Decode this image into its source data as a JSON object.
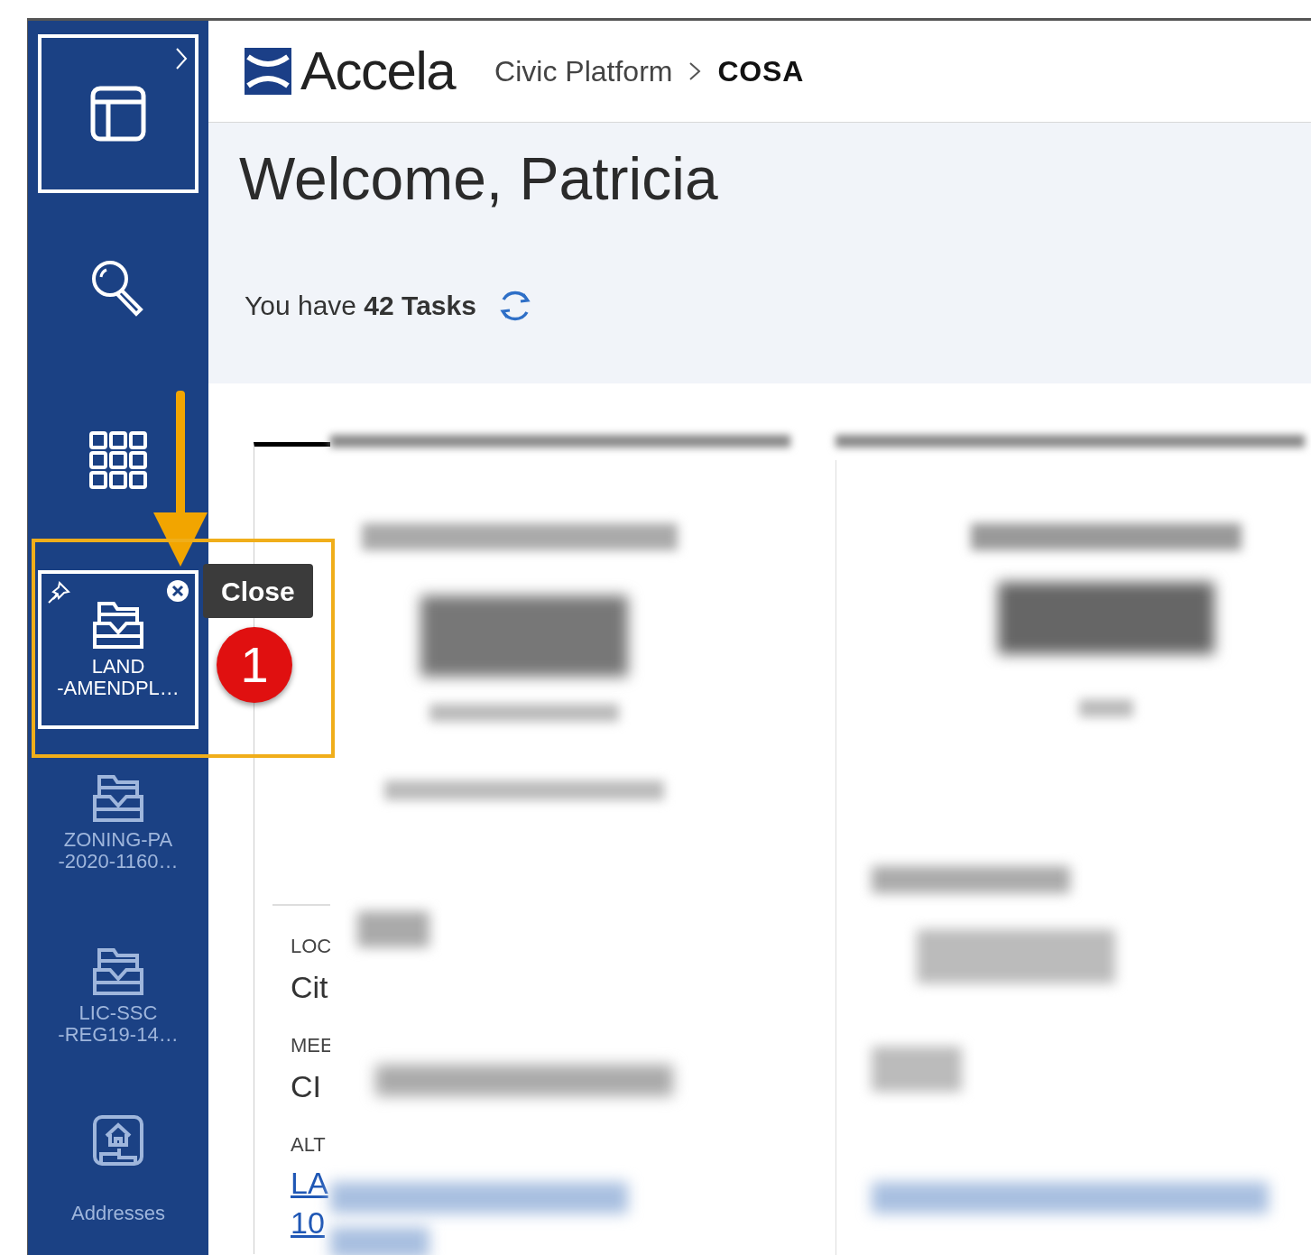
{
  "header": {
    "logo_text": "Accela",
    "breadcrumb": [
      {
        "label": "Civic Platform",
        "current": false
      },
      {
        "label": "COSA",
        "current": true
      }
    ]
  },
  "sidebar": {
    "items": [
      {
        "kind": "dashboard",
        "selected": true,
        "expand": true
      },
      {
        "kind": "search",
        "selected": false
      },
      {
        "kind": "apps",
        "selected": false
      },
      {
        "kind": "record",
        "selected": true,
        "label_lines": [
          "LAND",
          "-AMENDPL…"
        ]
      },
      {
        "kind": "record",
        "selected": false,
        "label_lines": [
          "ZONING-PA",
          "-2020-1160…"
        ]
      },
      {
        "kind": "record",
        "selected": false,
        "label_lines": [
          "LIC-SSC",
          "-REG19-14…"
        ]
      },
      {
        "kind": "addresses",
        "selected": false,
        "label_lines": [
          "Addresses"
        ]
      }
    ]
  },
  "welcome": {
    "title": "Welcome, Patricia",
    "tasks": "You have **42 Tasks**"
  },
  "card": {
    "fields": [
      {
        "kind": "text",
        "label": "LOC",
        "value_lines": [
          "Cit"
        ]
      },
      {
        "kind": "text",
        "label": "MEE",
        "value_lines": [
          "CI"
        ]
      },
      {
        "kind": "link",
        "label": "ALT",
        "value_lines": [
          "LA",
          "10"
        ]
      }
    ]
  },
  "tooltip": "Close",
  "annotation": {
    "step": "1"
  }
}
